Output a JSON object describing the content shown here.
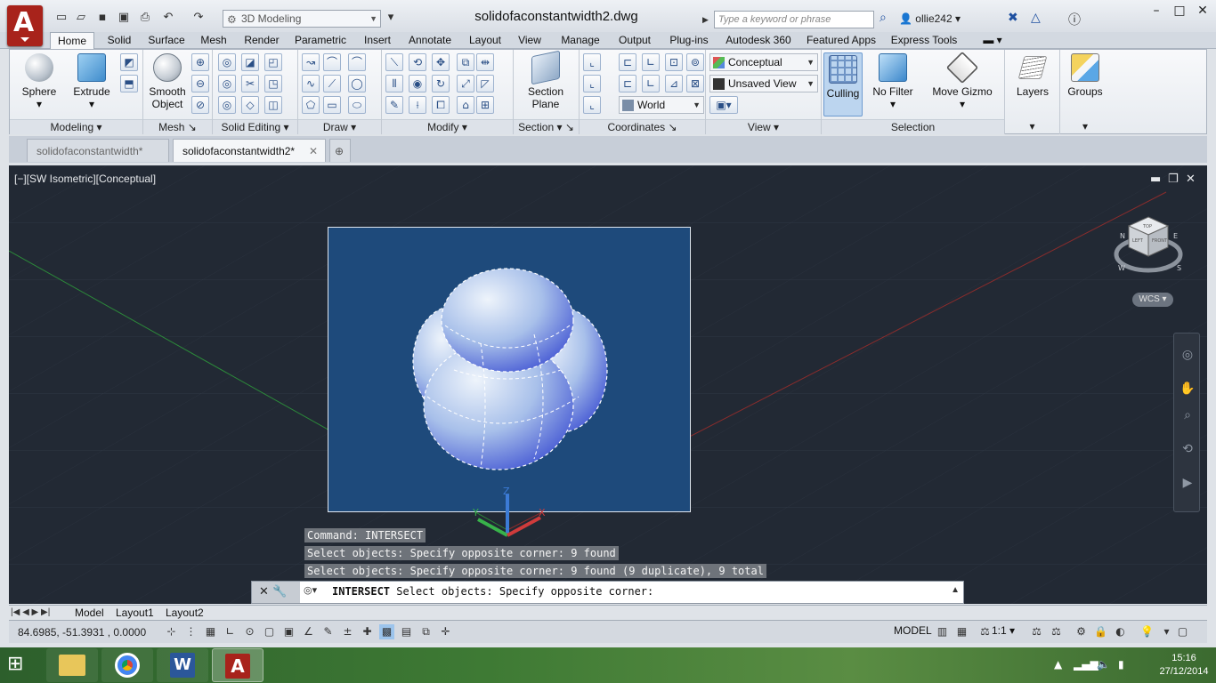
{
  "window": {
    "doc_title": "solidofaconstantwidth2.dwg",
    "workspace": "3D Modeling",
    "search_placeholder": "Type a keyword or phrase",
    "user": "ollie242",
    "help_icon": "?",
    "min": "–",
    "max": "□",
    "close": "✕"
  },
  "app_logo": "A",
  "ribbon_tabs": [
    "Home",
    "Solid",
    "Surface",
    "Mesh",
    "Render",
    "Parametric",
    "Insert",
    "Annotate",
    "Layout",
    "View",
    "Manage",
    "Output",
    "Plug-ins",
    "Autodesk 360",
    "Featured Apps",
    "Express Tools"
  ],
  "panels": {
    "modeling": {
      "title": "Modeling",
      "sphere": "Sphere",
      "extrude": "Extrude"
    },
    "mesh": {
      "title": "Mesh",
      "smooth_object": "Smooth Object"
    },
    "solid_editing": {
      "title": "Solid Editing"
    },
    "draw": {
      "title": "Draw"
    },
    "modify": {
      "title": "Modify"
    },
    "section": {
      "title": "Section",
      "section_plane": "Section Plane"
    },
    "coordinates": {
      "title": "Coordinates",
      "ucs": "World"
    },
    "view": {
      "title": "View",
      "visual_style": "Conceptual",
      "named_view": "Unsaved View"
    },
    "selection": {
      "title": "Selection",
      "culling": "Culling",
      "no_filter": "No Filter",
      "move_gizmo": "Move Gizmo"
    },
    "layers": {
      "label": "Layers"
    },
    "groups": {
      "label": "Groups"
    }
  },
  "doc_tabs": [
    "solidofaconstantwidth*",
    "solidofaconstantwidth2*"
  ],
  "viewport": {
    "label": "[−][SW Isometric][Conceptual]",
    "wcs": "WCS",
    "ucs_x": "X",
    "ucs_y": "Y",
    "ucs_z": "Z",
    "cube_top": "TOP",
    "cube_left": "LEFT",
    "cube_front": "FRONT",
    "compass_w": "W",
    "compass_s": "S",
    "compass_e": "E",
    "compass_n": "N"
  },
  "command_history": [
    "Command: INTERSECT",
    "Select objects: Specify opposite corner: 9 found",
    "Select objects: Specify opposite corner: 9 found (9 duplicate), 9 total"
  ],
  "command_line": {
    "command": "INTERSECT",
    "prompt": "Select objects: Specify opposite corner:"
  },
  "layout_tabs": [
    "Model",
    "Layout1",
    "Layout2"
  ],
  "status": {
    "coords": "84.6985, -51.3931 , 0.0000",
    "model": "MODEL",
    "scale": "1:1"
  },
  "taskbar": {
    "time": "15:16",
    "date": "27/12/2014"
  },
  "colors": {
    "viewport_bg": "#222934",
    "selection_bg": "#1e4a7b",
    "accent": "#a8231b"
  }
}
